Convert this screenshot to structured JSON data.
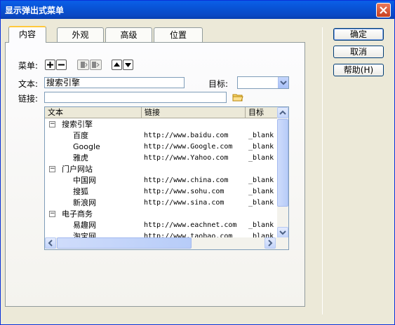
{
  "window": {
    "title": "显示弹出式菜单"
  },
  "tabs": [
    {
      "label": "内容"
    },
    {
      "label": "外观"
    },
    {
      "label": "高级"
    },
    {
      "label": "位置"
    }
  ],
  "form": {
    "menu_label": "菜单:",
    "text_label": "文本:",
    "text_value": "搜索引擎",
    "target_label": "目标:",
    "target_value": "",
    "link_label": "链接:",
    "link_value": ""
  },
  "grid": {
    "columns": [
      "文本",
      "链接",
      "目标"
    ],
    "rows": [
      {
        "text": "搜索引擎",
        "link": "",
        "target": "",
        "group": true,
        "expander": "−"
      },
      {
        "text": "百度",
        "link": "http://www.baidu.com",
        "target": "_blank"
      },
      {
        "text": "Google",
        "link": "http://www.Google.com",
        "target": "_blank"
      },
      {
        "text": "雅虎",
        "link": "http://www.Yahoo.com",
        "target": "_blank"
      },
      {
        "text": "门户网站",
        "link": "",
        "target": "",
        "group": true,
        "expander": "−"
      },
      {
        "text": "中国网",
        "link": "http://www.china.com",
        "target": "_blank"
      },
      {
        "text": "搜狐",
        "link": "http://www.sohu.com",
        "target": "_blank"
      },
      {
        "text": "新浪网",
        "link": "http://www.sina.com",
        "target": "_blank"
      },
      {
        "text": "电子商务",
        "link": "",
        "target": "",
        "group": true,
        "expander": "−"
      },
      {
        "text": "易趣网",
        "link": "http://www.eachnet.com",
        "target": "_blank"
      },
      {
        "text": "淘宝网",
        "link": "http://www.taobao.com",
        "target": "_blank"
      }
    ]
  },
  "buttons": {
    "ok": "确定",
    "cancel": "取消",
    "help": "帮助(H)"
  },
  "colors": {
    "titlebar": "#0a5fe8",
    "tab_highlight": "#ffc83c",
    "dialog_bg": "#ece9d8"
  }
}
